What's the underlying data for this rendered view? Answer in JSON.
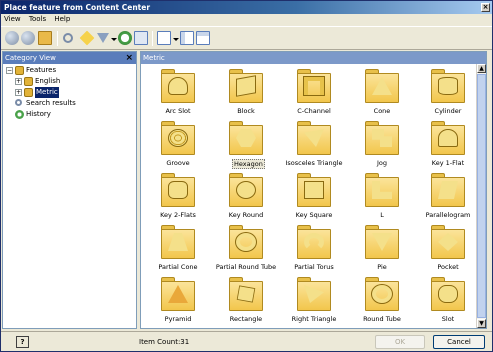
{
  "window": {
    "title": "Place feature from Content Center"
  },
  "menu": [
    {
      "label": "View"
    },
    {
      "label": "Tools"
    },
    {
      "label": "Help"
    }
  ],
  "left_pane": {
    "title": "Category View",
    "tree": [
      {
        "label": "Features",
        "expander": "−",
        "icon": "features-icon",
        "selected": false
      },
      {
        "label": "English",
        "expander": "+",
        "icon": "features-icon",
        "selected": false
      },
      {
        "label": "Metric",
        "expander": "+",
        "icon": "features-icon",
        "selected": true
      },
      {
        "label": "Search results",
        "expander": "",
        "icon": "search-icon",
        "selected": false
      },
      {
        "label": "History",
        "expander": "",
        "icon": "history-icon",
        "selected": false
      }
    ]
  },
  "right_pane": {
    "title": "Metric",
    "items": [
      {
        "label": "Arc Slot",
        "icon": "arc-slot-icon"
      },
      {
        "label": "Block",
        "icon": "block-icon"
      },
      {
        "label": "C-Channel",
        "icon": "c-channel-icon"
      },
      {
        "label": "Cone",
        "icon": "cone-icon"
      },
      {
        "label": "Cylinder",
        "icon": "cylinder-icon"
      },
      {
        "label": "Groove",
        "icon": "groove-icon"
      },
      {
        "label": "Hexagon",
        "icon": "hexagon-icon",
        "selected": true
      },
      {
        "label": "Isosceles Triangle",
        "icon": "isosceles-triangle-icon"
      },
      {
        "label": "Jog",
        "icon": "jog-icon"
      },
      {
        "label": "Key 1-Flat",
        "icon": "key-1-flat-icon"
      },
      {
        "label": "Key 2-Flats",
        "icon": "key-2-flats-icon"
      },
      {
        "label": "Key Round",
        "icon": "key-round-icon"
      },
      {
        "label": "Key Square",
        "icon": "key-square-icon"
      },
      {
        "label": "L",
        "icon": "l-shape-icon"
      },
      {
        "label": "Parallelogram",
        "icon": "parallelogram-icon"
      },
      {
        "label": "Partial Cone",
        "icon": "partial-cone-icon"
      },
      {
        "label": "Partial Round Tube",
        "icon": "partial-round-tube-icon"
      },
      {
        "label": "Partial Torus",
        "icon": "partial-torus-icon"
      },
      {
        "label": "Pie",
        "icon": "pie-icon"
      },
      {
        "label": "Pocket",
        "icon": "pocket-icon"
      },
      {
        "label": "Pyramid",
        "icon": "pyramid-icon"
      },
      {
        "label": "Rectangle",
        "icon": "rectangle-icon"
      },
      {
        "label": "Right Triangle",
        "icon": "right-triangle-icon"
      },
      {
        "label": "Round Tube",
        "icon": "round-tube-icon"
      },
      {
        "label": "Slot",
        "icon": "slot-icon"
      }
    ]
  },
  "status": {
    "item_count": "Item Count:31"
  },
  "buttons": {
    "ok": "OK",
    "cancel": "Cancel",
    "help": "?"
  },
  "colors": {
    "title_bar": "#0a246a",
    "selection": "#0a246a",
    "folder": "#f2c64c",
    "pane_header": "#5a7dbb"
  }
}
